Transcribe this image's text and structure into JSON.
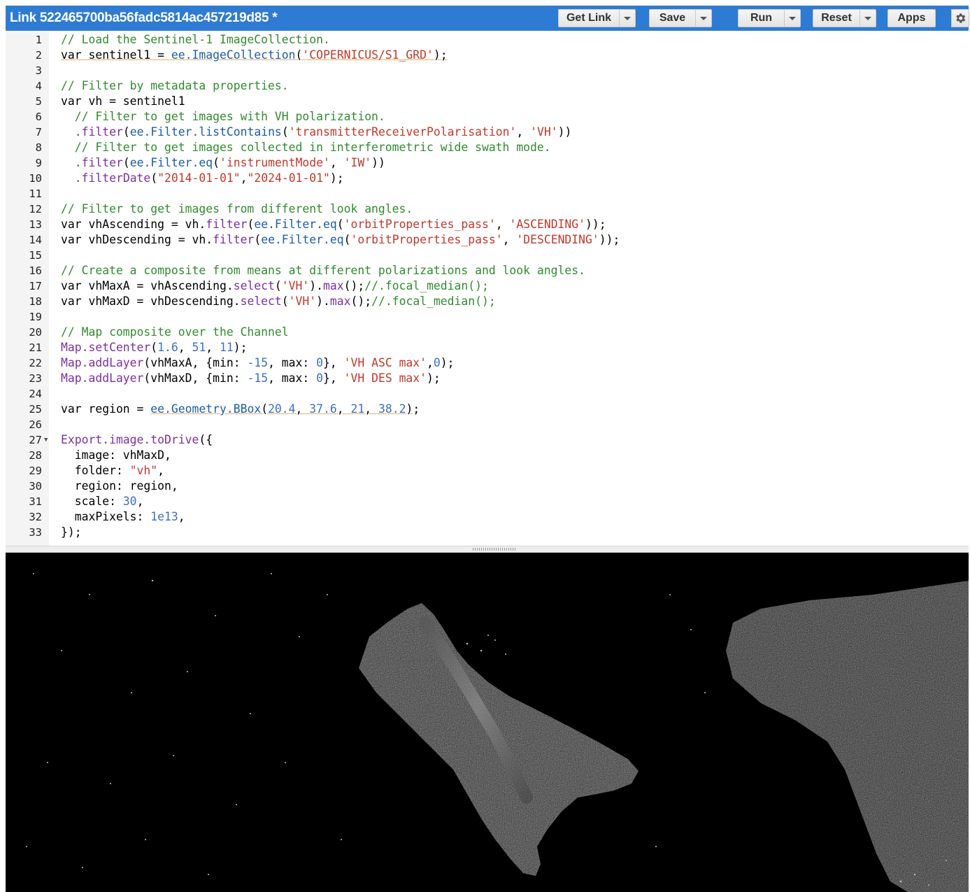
{
  "header": {
    "title": "Link 522465700ba56fadc5814ac457219d85 *",
    "buttons": {
      "get_link": "Get Link",
      "save": "Save",
      "run": "Run",
      "reset": "Reset",
      "apps": "Apps"
    },
    "settings_icon": "gear-icon",
    "colors": {
      "header_bg": "#2d7bd3",
      "button_bg": "#eeeeee"
    }
  },
  "editor": {
    "line_numbers": [
      "1",
      "2",
      "3",
      "4",
      "5",
      "6",
      "7",
      "8",
      "9",
      "10",
      "11",
      "12",
      "13",
      "14",
      "15",
      "16",
      "17",
      "18",
      "19",
      "20",
      "21",
      "22",
      "23",
      "24",
      "25",
      "26",
      "27",
      "28",
      "29",
      "30",
      "31",
      "32",
      "33"
    ],
    "fold_marker_line": "27",
    "lines": [
      "// Load the Sentinel-1 ImageCollection.",
      "var sentinel1 = ee.ImageCollection('COPERNICUS/S1_GRD');",
      "",
      "// Filter by metadata properties.",
      "var vh = sentinel1",
      "  // Filter to get images with VH polarization.",
      "  .filter(ee.Filter.listContains('transmitterReceiverPolarisation', 'VH'))",
      "  // Filter to get images collected in interferometric wide swath mode.",
      "  .filter(ee.Filter.eq('instrumentMode', 'IW'))",
      "  .filterDate(\"2014-01-01\",\"2024-01-01\");",
      "",
      "// Filter to get images from different look angles.",
      "var vhAscending = vh.filter(ee.Filter.eq('orbitProperties_pass', 'ASCENDING'));",
      "var vhDescending = vh.filter(ee.Filter.eq('orbitProperties_pass', 'DESCENDING'));",
      "",
      "// Create a composite from means at different polarizations and look angles.",
      "var vhMaxA = vhAscending.select('VH').max();//.focal_median();",
      "var vhMaxD = vhDescending.select('VH').max();//.focal_median();",
      "",
      "// Map composite over the Channel",
      "Map.setCenter(1.6, 51, 11);",
      "Map.addLayer(vhMaxA, {min: -15, max: 0}, 'VH ASC max',0);",
      "Map.addLayer(vhMaxD, {min: -15, max: 0}, 'VH DES max');",
      "",
      "var region = ee.Geometry.BBox(20.4, 37.6, 21, 38.2);",
      "",
      "Export.image.toDrive({",
      "  image: vhMaxD,",
      "  folder: \"vh\",",
      "  region: region,",
      "  scale: 30,",
      "  maxPixels: 1e13,",
      "});"
    ],
    "colors": {
      "comment": "#318b2f",
      "string": "#c0392b",
      "number": "#3b6fc6",
      "function": "#7b2fa5",
      "object": "#1c5ca8"
    }
  },
  "map": {
    "description_icon": "radar-map-icon",
    "colors": {
      "background": "#000000",
      "land": "#3a3a3a"
    }
  }
}
